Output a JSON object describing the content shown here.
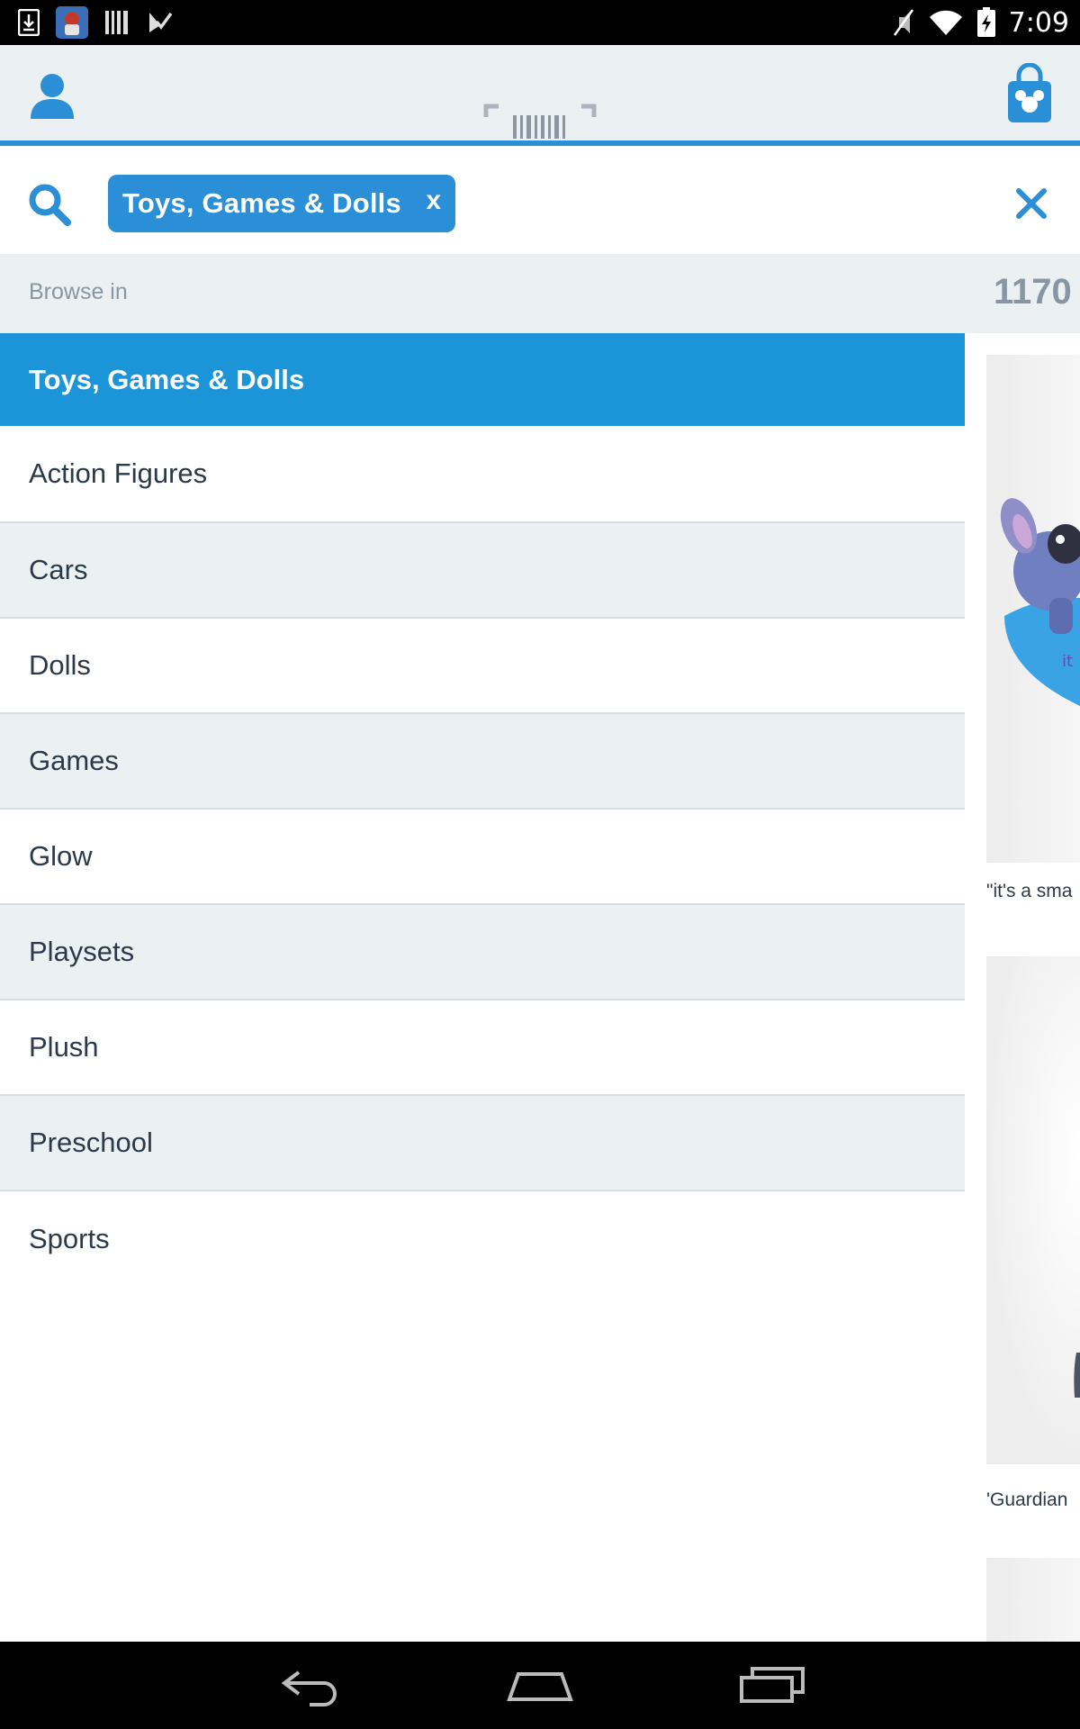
{
  "status_bar": {
    "time": "7:09",
    "icons": [
      "download-icon",
      "app-notification-icon",
      "barcode-icon",
      "checkmark-icon",
      "mute-icon",
      "wifi-icon",
      "battery-charging-icon"
    ]
  },
  "header": {
    "icons": [
      "user-icon",
      "barcode-scan-icon",
      "shopping-bag-icon"
    ],
    "accent": "#2a8fd6"
  },
  "search": {
    "filter_chip": {
      "label": "Toys, Games & Dolls",
      "remove": "x"
    },
    "icons": [
      "search-icon",
      "close-icon"
    ]
  },
  "browse": {
    "label": "Browse in",
    "result_count": "1170"
  },
  "categories": [
    {
      "label": "Toys, Games & Dolls",
      "selected": true
    },
    {
      "label": "Action Figures"
    },
    {
      "label": "Cars"
    },
    {
      "label": "Dolls"
    },
    {
      "label": "Games"
    },
    {
      "label": "Glow"
    },
    {
      "label": "Playsets"
    },
    {
      "label": "Plush"
    },
    {
      "label": "Preschool"
    },
    {
      "label": "Sports"
    }
  ],
  "products": [
    {
      "title": "\"it's a sma"
    },
    {
      "title": "'Guardian"
    }
  ],
  "nav_bar": {
    "icons": [
      "back-icon",
      "home-icon",
      "recent-apps-icon"
    ]
  },
  "colors": {
    "selected": "#1c95d8",
    "alt_row": "#ebf0f3",
    "muted_text": "#8896a4"
  }
}
